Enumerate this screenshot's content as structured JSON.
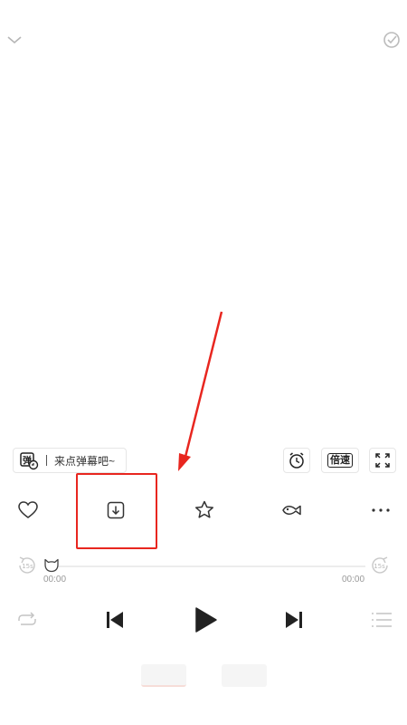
{
  "header": {
    "collapse_icon": "chevron-down-icon",
    "right_icon": "check-circle-icon"
  },
  "danmu": {
    "toggle_icon_text": "弹",
    "placeholder": "来点弹幕吧~"
  },
  "controls": {
    "alarm_icon": "alarm-clock-icon",
    "speed_label": "倍速",
    "fullscreen_icon": "expand-icon"
  },
  "actions": [
    {
      "icon": "heart-icon"
    },
    {
      "icon": "download-icon"
    },
    {
      "icon": "star-icon"
    },
    {
      "icon": "fish-icon"
    },
    {
      "icon": "more-icon"
    }
  ],
  "progress": {
    "rewind_label": "15s",
    "forward_label": "15s",
    "current_time": "00:00",
    "total_time": "00:00",
    "value": 0
  },
  "playback": {
    "repeat_icon": "repeat-icon",
    "prev_icon": "skip-previous-icon",
    "play_icon": "play-icon",
    "next_icon": "skip-next-icon",
    "playlist_icon": "playlist-icon"
  },
  "colors": {
    "accent_annotation": "#e8261f",
    "icon": "#333333",
    "muted": "#cccccc"
  }
}
